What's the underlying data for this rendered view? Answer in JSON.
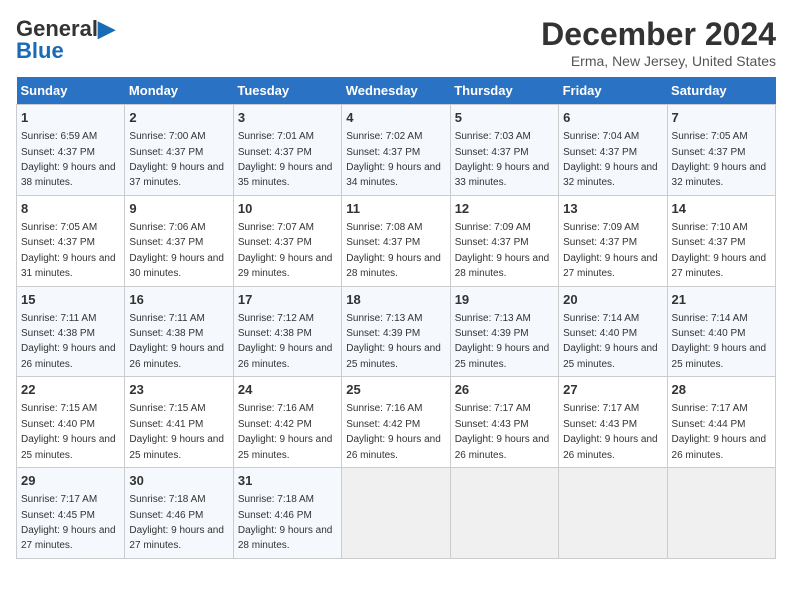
{
  "header": {
    "logo_line1": "General",
    "logo_line2": "Blue",
    "main_title": "December 2024",
    "subtitle": "Erma, New Jersey, United States"
  },
  "calendar": {
    "days_of_week": [
      "Sunday",
      "Monday",
      "Tuesday",
      "Wednesday",
      "Thursday",
      "Friday",
      "Saturday"
    ],
    "weeks": [
      [
        {
          "day": "1",
          "sunrise": "Sunrise: 6:59 AM",
          "sunset": "Sunset: 4:37 PM",
          "daylight": "Daylight: 9 hours and 38 minutes."
        },
        {
          "day": "2",
          "sunrise": "Sunrise: 7:00 AM",
          "sunset": "Sunset: 4:37 PM",
          "daylight": "Daylight: 9 hours and 37 minutes."
        },
        {
          "day": "3",
          "sunrise": "Sunrise: 7:01 AM",
          "sunset": "Sunset: 4:37 PM",
          "daylight": "Daylight: 9 hours and 35 minutes."
        },
        {
          "day": "4",
          "sunrise": "Sunrise: 7:02 AM",
          "sunset": "Sunset: 4:37 PM",
          "daylight": "Daylight: 9 hours and 34 minutes."
        },
        {
          "day": "5",
          "sunrise": "Sunrise: 7:03 AM",
          "sunset": "Sunset: 4:37 PM",
          "daylight": "Daylight: 9 hours and 33 minutes."
        },
        {
          "day": "6",
          "sunrise": "Sunrise: 7:04 AM",
          "sunset": "Sunset: 4:37 PM",
          "daylight": "Daylight: 9 hours and 32 minutes."
        },
        {
          "day": "7",
          "sunrise": "Sunrise: 7:05 AM",
          "sunset": "Sunset: 4:37 PM",
          "daylight": "Daylight: 9 hours and 32 minutes."
        }
      ],
      [
        {
          "day": "8",
          "sunrise": "Sunrise: 7:05 AM",
          "sunset": "Sunset: 4:37 PM",
          "daylight": "Daylight: 9 hours and 31 minutes."
        },
        {
          "day": "9",
          "sunrise": "Sunrise: 7:06 AM",
          "sunset": "Sunset: 4:37 PM",
          "daylight": "Daylight: 9 hours and 30 minutes."
        },
        {
          "day": "10",
          "sunrise": "Sunrise: 7:07 AM",
          "sunset": "Sunset: 4:37 PM",
          "daylight": "Daylight: 9 hours and 29 minutes."
        },
        {
          "day": "11",
          "sunrise": "Sunrise: 7:08 AM",
          "sunset": "Sunset: 4:37 PM",
          "daylight": "Daylight: 9 hours and 28 minutes."
        },
        {
          "day": "12",
          "sunrise": "Sunrise: 7:09 AM",
          "sunset": "Sunset: 4:37 PM",
          "daylight": "Daylight: 9 hours and 28 minutes."
        },
        {
          "day": "13",
          "sunrise": "Sunrise: 7:09 AM",
          "sunset": "Sunset: 4:37 PM",
          "daylight": "Daylight: 9 hours and 27 minutes."
        },
        {
          "day": "14",
          "sunrise": "Sunrise: 7:10 AM",
          "sunset": "Sunset: 4:37 PM",
          "daylight": "Daylight: 9 hours and 27 minutes."
        }
      ],
      [
        {
          "day": "15",
          "sunrise": "Sunrise: 7:11 AM",
          "sunset": "Sunset: 4:38 PM",
          "daylight": "Daylight: 9 hours and 26 minutes."
        },
        {
          "day": "16",
          "sunrise": "Sunrise: 7:11 AM",
          "sunset": "Sunset: 4:38 PM",
          "daylight": "Daylight: 9 hours and 26 minutes."
        },
        {
          "day": "17",
          "sunrise": "Sunrise: 7:12 AM",
          "sunset": "Sunset: 4:38 PM",
          "daylight": "Daylight: 9 hours and 26 minutes."
        },
        {
          "day": "18",
          "sunrise": "Sunrise: 7:13 AM",
          "sunset": "Sunset: 4:39 PM",
          "daylight": "Daylight: 9 hours and 25 minutes."
        },
        {
          "day": "19",
          "sunrise": "Sunrise: 7:13 AM",
          "sunset": "Sunset: 4:39 PM",
          "daylight": "Daylight: 9 hours and 25 minutes."
        },
        {
          "day": "20",
          "sunrise": "Sunrise: 7:14 AM",
          "sunset": "Sunset: 4:40 PM",
          "daylight": "Daylight: 9 hours and 25 minutes."
        },
        {
          "day": "21",
          "sunrise": "Sunrise: 7:14 AM",
          "sunset": "Sunset: 4:40 PM",
          "daylight": "Daylight: 9 hours and 25 minutes."
        }
      ],
      [
        {
          "day": "22",
          "sunrise": "Sunrise: 7:15 AM",
          "sunset": "Sunset: 4:40 PM",
          "daylight": "Daylight: 9 hours and 25 minutes."
        },
        {
          "day": "23",
          "sunrise": "Sunrise: 7:15 AM",
          "sunset": "Sunset: 4:41 PM",
          "daylight": "Daylight: 9 hours and 25 minutes."
        },
        {
          "day": "24",
          "sunrise": "Sunrise: 7:16 AM",
          "sunset": "Sunset: 4:42 PM",
          "daylight": "Daylight: 9 hours and 25 minutes."
        },
        {
          "day": "25",
          "sunrise": "Sunrise: 7:16 AM",
          "sunset": "Sunset: 4:42 PM",
          "daylight": "Daylight: 9 hours and 26 minutes."
        },
        {
          "day": "26",
          "sunrise": "Sunrise: 7:17 AM",
          "sunset": "Sunset: 4:43 PM",
          "daylight": "Daylight: 9 hours and 26 minutes."
        },
        {
          "day": "27",
          "sunrise": "Sunrise: 7:17 AM",
          "sunset": "Sunset: 4:43 PM",
          "daylight": "Daylight: 9 hours and 26 minutes."
        },
        {
          "day": "28",
          "sunrise": "Sunrise: 7:17 AM",
          "sunset": "Sunset: 4:44 PM",
          "daylight": "Daylight: 9 hours and 26 minutes."
        }
      ],
      [
        {
          "day": "29",
          "sunrise": "Sunrise: 7:17 AM",
          "sunset": "Sunset: 4:45 PM",
          "daylight": "Daylight: 9 hours and 27 minutes."
        },
        {
          "day": "30",
          "sunrise": "Sunrise: 7:18 AM",
          "sunset": "Sunset: 4:46 PM",
          "daylight": "Daylight: 9 hours and 27 minutes."
        },
        {
          "day": "31",
          "sunrise": "Sunrise: 7:18 AM",
          "sunset": "Sunset: 4:46 PM",
          "daylight": "Daylight: 9 hours and 28 minutes."
        },
        null,
        null,
        null,
        null
      ]
    ]
  }
}
